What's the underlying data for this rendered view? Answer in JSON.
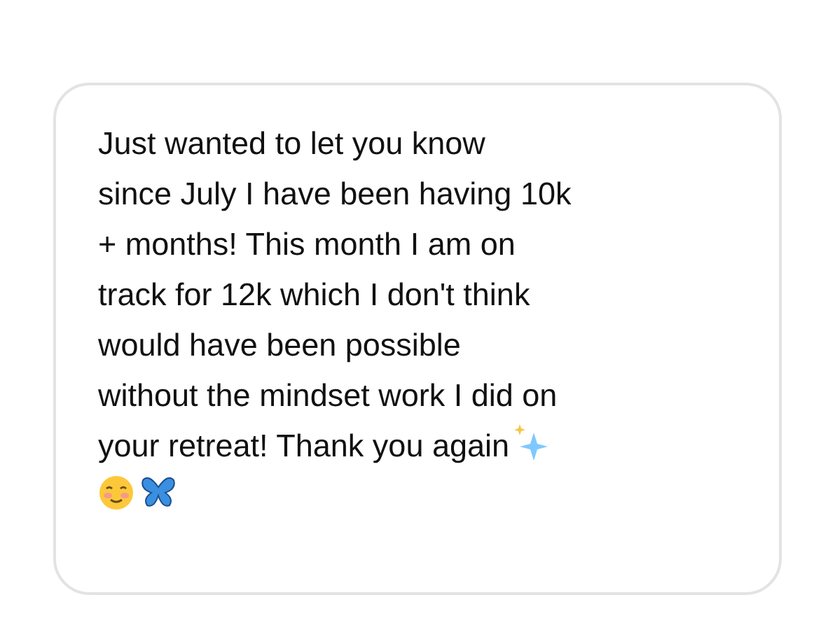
{
  "message": {
    "lines": [
      "Just wanted to let you know",
      "since July I have been having 10k",
      "+ months! This month I am on",
      "track for 12k which I don't think",
      "would have been possible",
      "without the mindset work I did on",
      "your retreat! Thank you again"
    ]
  }
}
